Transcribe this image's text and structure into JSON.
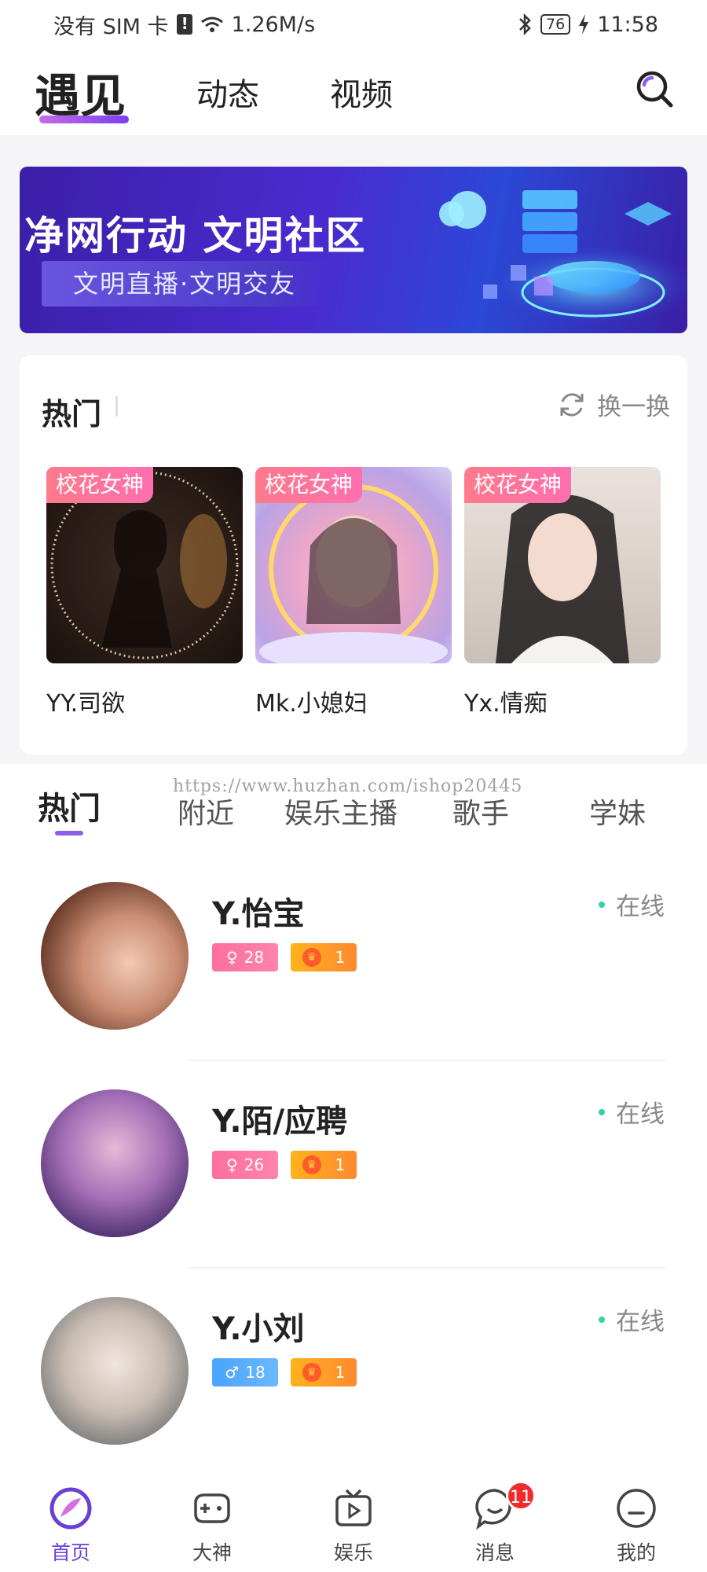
{
  "status_bar": {
    "carrier": "没有 SIM 卡",
    "speed": "1.26M/s",
    "battery": "76",
    "time": "11:58"
  },
  "header": {
    "tabs": [
      {
        "label": "遇见",
        "active": true
      },
      {
        "label": "动态",
        "active": false
      },
      {
        "label": "视频",
        "active": false
      }
    ],
    "search_icon": "search-icon"
  },
  "banner": {
    "title": "净网行动 文明社区",
    "subtitle": "文明直播·文明交友"
  },
  "hot": {
    "title": "热门",
    "refresh_label": "换一换",
    "cards": [
      {
        "badge": "校花女神",
        "name": "YY.司欲"
      },
      {
        "badge": "校花女神",
        "name": "Mk.小媳妇"
      },
      {
        "badge": "校花女神",
        "name": "Yx.情痴"
      }
    ]
  },
  "watermark": "https://www.huzhan.com/ishop20445",
  "category_tabs": [
    {
      "label": "热门",
      "active": true
    },
    {
      "label": "附近",
      "active": false
    },
    {
      "label": "娱乐主播",
      "active": false
    },
    {
      "label": "歌手",
      "active": false
    },
    {
      "label": "学妹",
      "active": false
    }
  ],
  "users": [
    {
      "name": "Y.怡宝",
      "gender": "female",
      "gender_symbol": "♀",
      "age": "28",
      "level": "1",
      "status": "在线"
    },
    {
      "name": "Y.陌/应聘",
      "gender": "female",
      "gender_symbol": "♀",
      "age": "26",
      "level": "1",
      "status": "在线"
    },
    {
      "name": "Y.小刘",
      "gender": "male",
      "gender_symbol": "♂",
      "age": "18",
      "level": "1",
      "status": "在线"
    }
  ],
  "bottom_nav": [
    {
      "label": "首页",
      "icon": "home-planet-icon",
      "active": true
    },
    {
      "label": "大神",
      "icon": "gamepad-icon",
      "active": false
    },
    {
      "label": "娱乐",
      "icon": "tv-play-icon",
      "active": false
    },
    {
      "label": "消息",
      "icon": "chat-bubble-icon",
      "active": false,
      "badge": "11"
    },
    {
      "label": "我的",
      "icon": "profile-face-icon",
      "active": false
    }
  ],
  "colors": {
    "accent": "#8f5de8",
    "online": "#33d1a6",
    "badge_red": "#f02b2b"
  }
}
